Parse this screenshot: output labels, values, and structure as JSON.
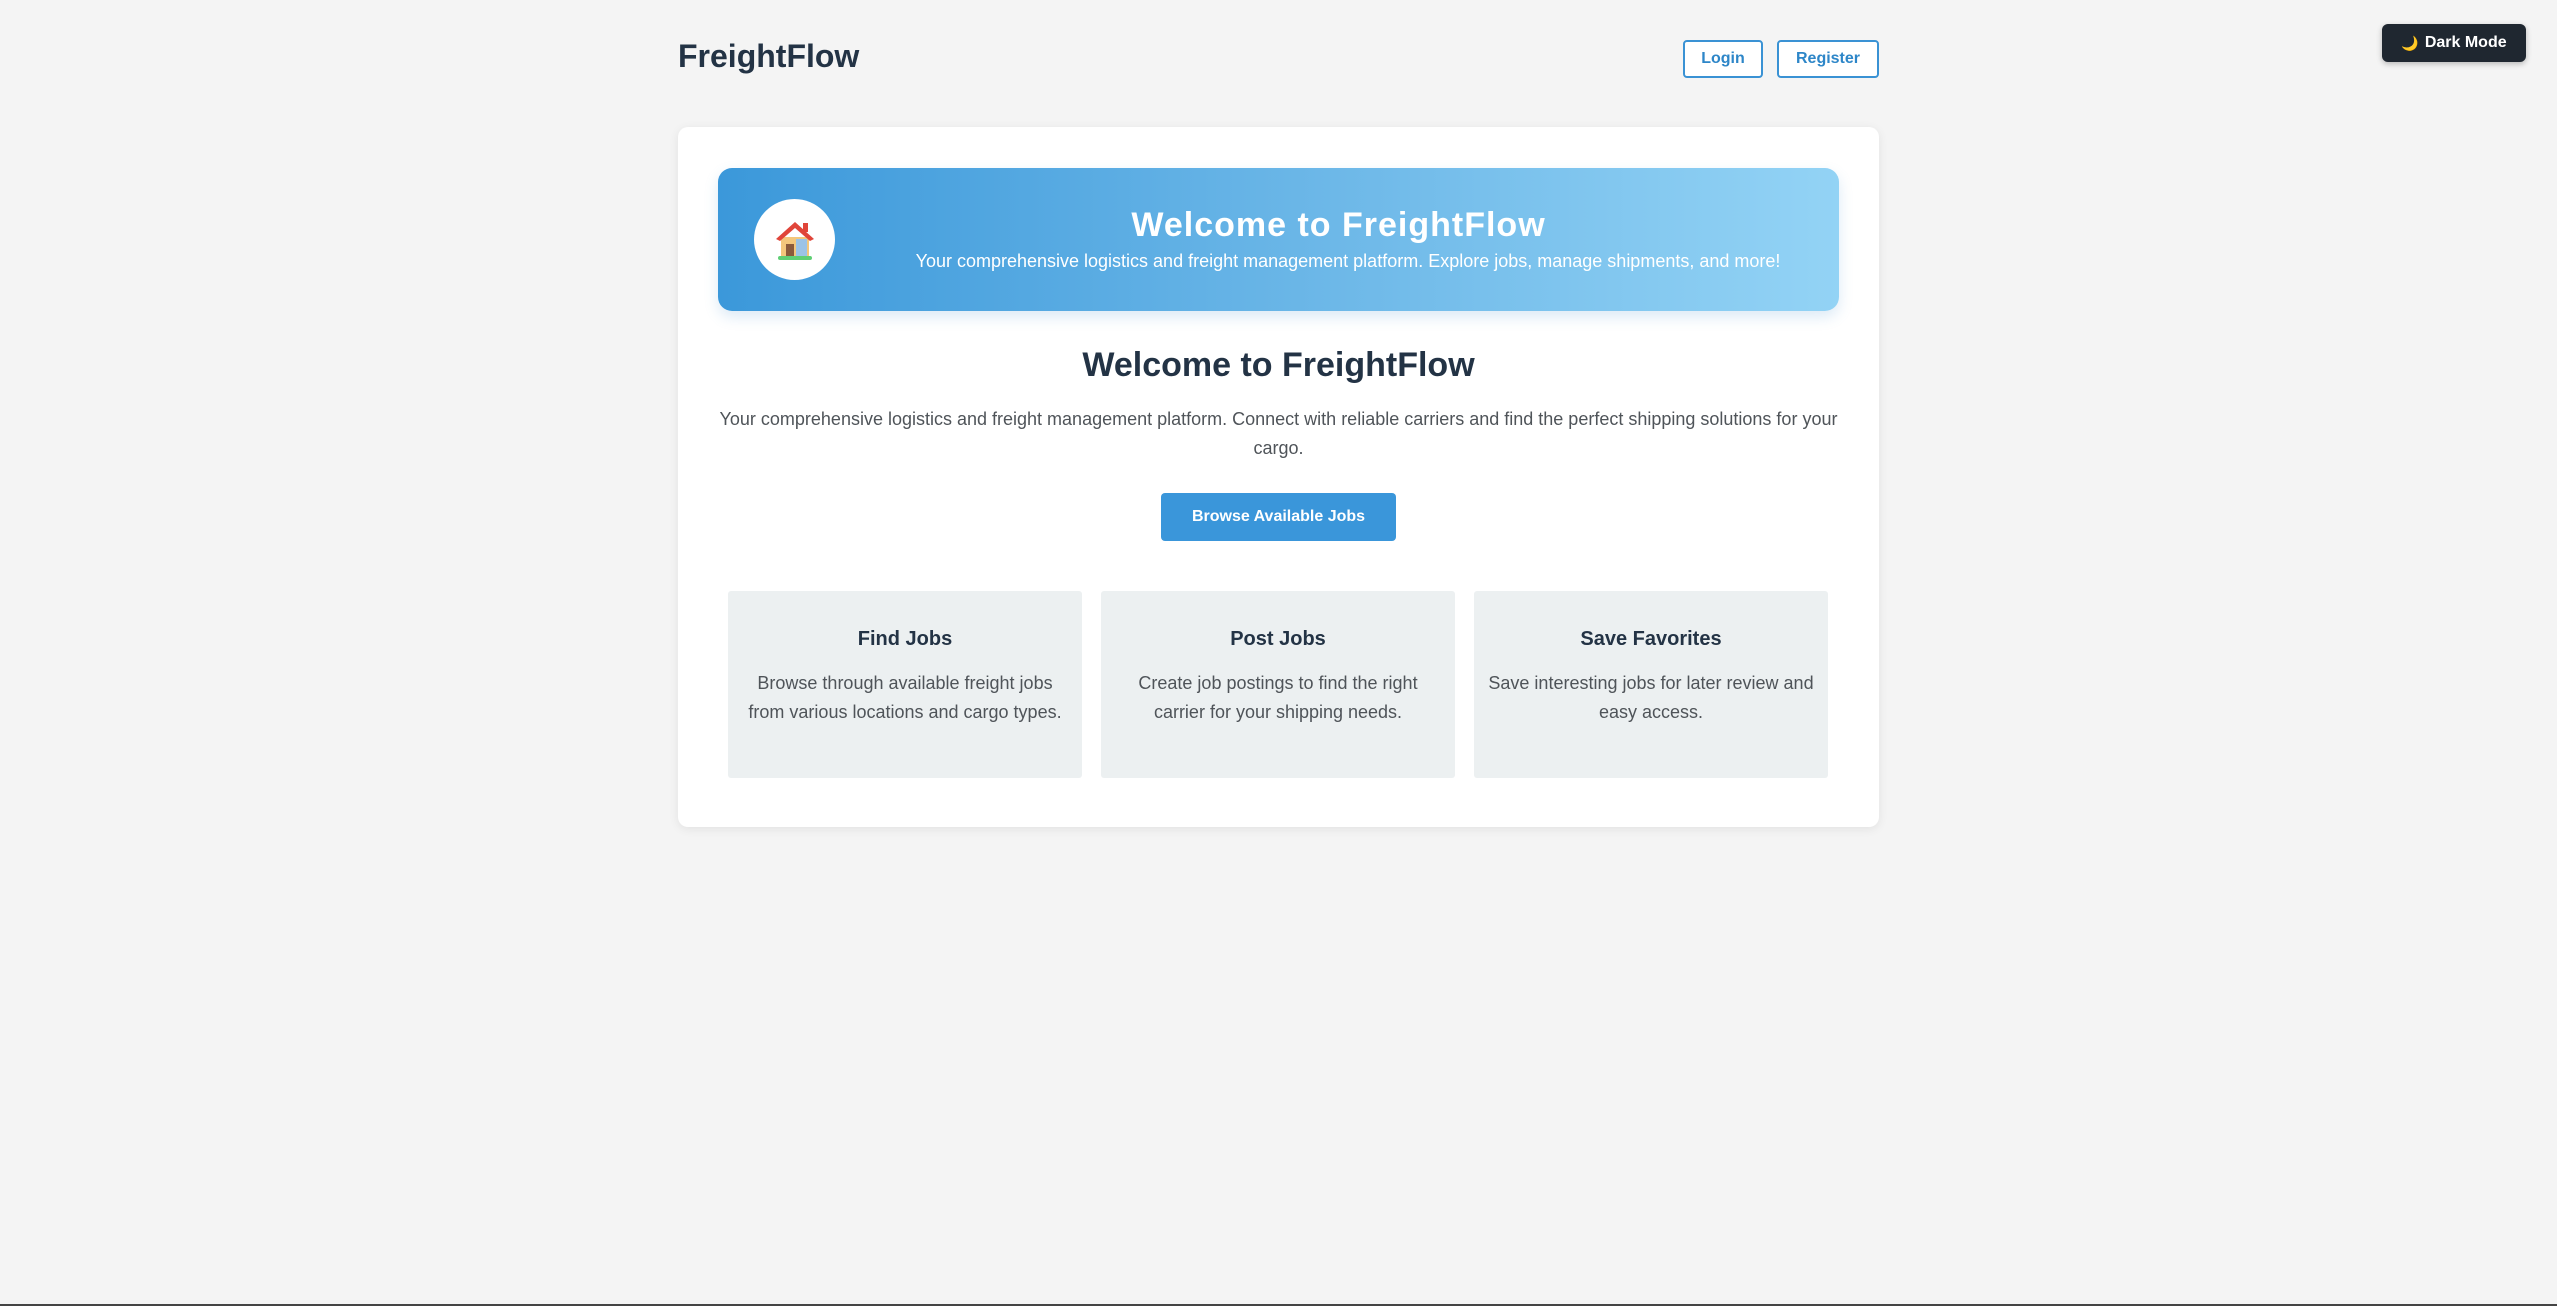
{
  "header": {
    "brand": "FreightFlow",
    "login_label": "Login",
    "register_label": "Register",
    "dark_mode_label": "Dark Mode",
    "dark_mode_icon": "moon-icon"
  },
  "hero": {
    "icon": "house-icon",
    "title": "Welcome to FreightFlow",
    "subtitle": "Your comprehensive logistics and freight management platform. Explore jobs, manage shipments, and more!"
  },
  "main": {
    "title": "Welcome to FreightFlow",
    "description": "Your comprehensive logistics and freight management platform. Connect with reliable carriers and find the perfect shipping solutions for your cargo.",
    "cta_label": "Browse Available Jobs"
  },
  "features": [
    {
      "title": "Find Jobs",
      "description": "Browse through available freight jobs from various locations and cargo types."
    },
    {
      "title": "Post Jobs",
      "description": "Create job postings to find the right carrier for your shipping needs."
    },
    {
      "title": "Save Favorites",
      "description": "Save interesting jobs for later review and easy access."
    }
  ],
  "colors": {
    "background": "#f4f4f4",
    "primary": "#3a96da",
    "heading": "#233345",
    "dark_button": "#1f2730",
    "feature_card": "#ecf0f1"
  }
}
